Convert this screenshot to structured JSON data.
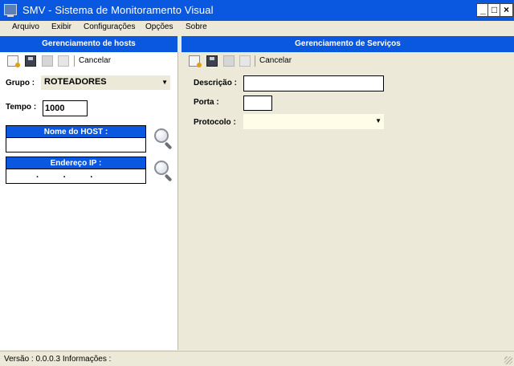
{
  "window": {
    "title": "SMV - Sistema de Monitoramento Visual",
    "min_glyph": "_",
    "max_glyph": "□",
    "close_glyph": "×"
  },
  "menu": {
    "items": [
      "Arquivo",
      "Exibir",
      "Configurações",
      "Opções",
      "Sobre"
    ]
  },
  "hosts": {
    "header": "Gerenciamento de hosts",
    "toolbar": {
      "cancel": "Cancelar"
    },
    "grupo_label": "Grupo :",
    "grupo_value": "ROTEADORES",
    "tempo_label": "Tempo :",
    "tempo_value": "1000",
    "nome_host_label": "Nome do HOST :",
    "nome_host_value": "",
    "endereco_ip_label": "Endereço IP :",
    "endereco_ip_value": ".          .          ."
  },
  "servicos": {
    "header": "Gerenciamento de Serviços",
    "toolbar": {
      "cancel": "Cancelar"
    },
    "descricao_label": "Descrição :",
    "porta_label": "Porta :",
    "protocolo_label": "Protocolo :"
  },
  "status": {
    "text": "Versão : 0.0.0.3  Informações :"
  },
  "colors": {
    "titlebar": "#0a58e0",
    "header": "#0a58e0",
    "face": "#ece9d8",
    "protocol_combo": "#fffce8"
  },
  "icons": [
    "app-icon",
    "new-icon",
    "save-icon",
    "edit-icon",
    "delete-icon",
    "search-icon",
    "resize-grip-icon"
  ]
}
